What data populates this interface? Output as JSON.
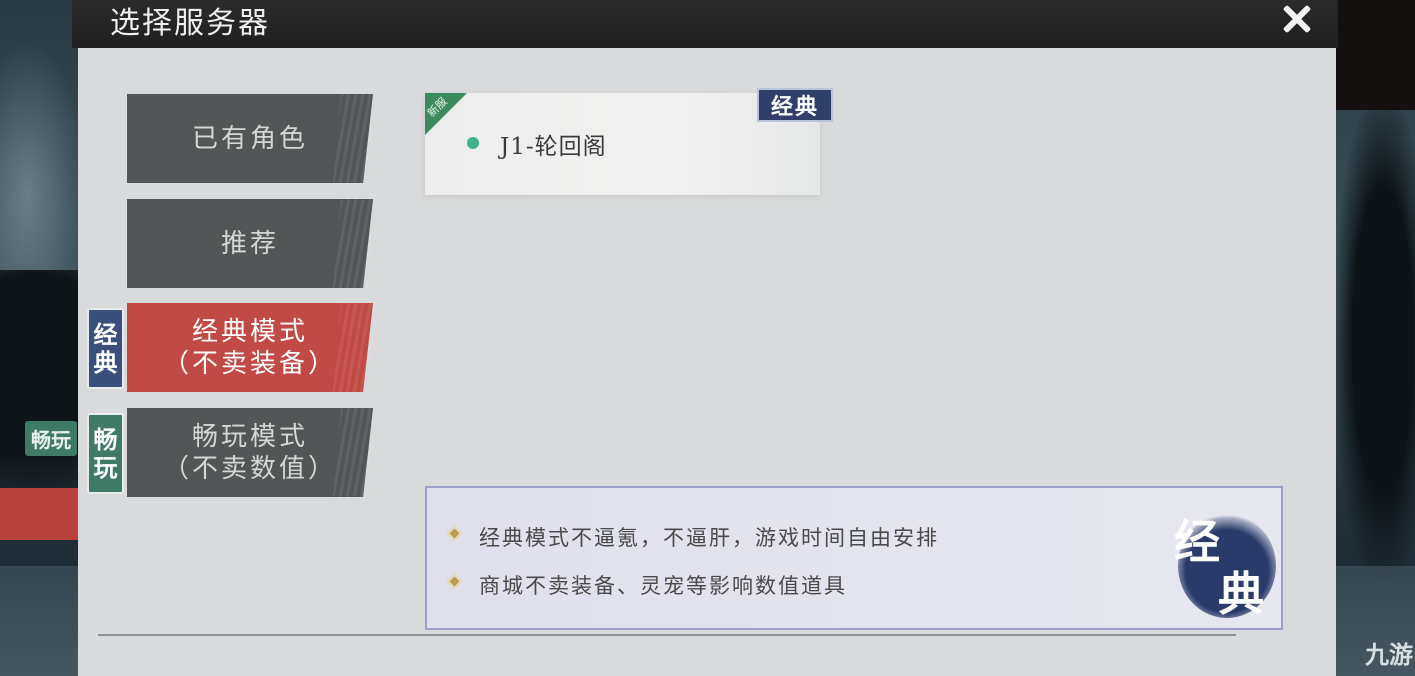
{
  "dialog": {
    "title": "选择服务器",
    "close_icon": "close-icon"
  },
  "menu": {
    "items": [
      {
        "lines": [
          "已有角色"
        ],
        "active": false
      },
      {
        "lines": [
          "推荐"
        ],
        "active": false
      },
      {
        "lines": [
          "经典模式",
          "（不卖装备）"
        ],
        "active": true
      },
      {
        "lines": [
          "畅玩模式",
          "（不卖数值）"
        ],
        "active": false
      }
    ],
    "side_tags": {
      "classic": [
        "经",
        "典"
      ],
      "free": [
        "畅",
        "玩"
      ]
    }
  },
  "server": {
    "new_label": "新服",
    "name": "J1-轮回阁",
    "mode_badge": "经典",
    "status_color": "#3bb58a"
  },
  "description": {
    "lines": [
      "经典模式不逼氪，不逼肝，游戏时间自由安排",
      "商城不卖装备、灵宠等影响数值道具"
    ],
    "brush_chars": [
      "经",
      "典"
    ]
  },
  "background": {
    "stray_tag": "畅玩"
  },
  "watermark": "九游",
  "colors": {
    "active_tab": "#c14a45",
    "inactive_tab": "#525657",
    "classic_tag": "#3b4f7c",
    "free_tag": "#3f7a67"
  }
}
